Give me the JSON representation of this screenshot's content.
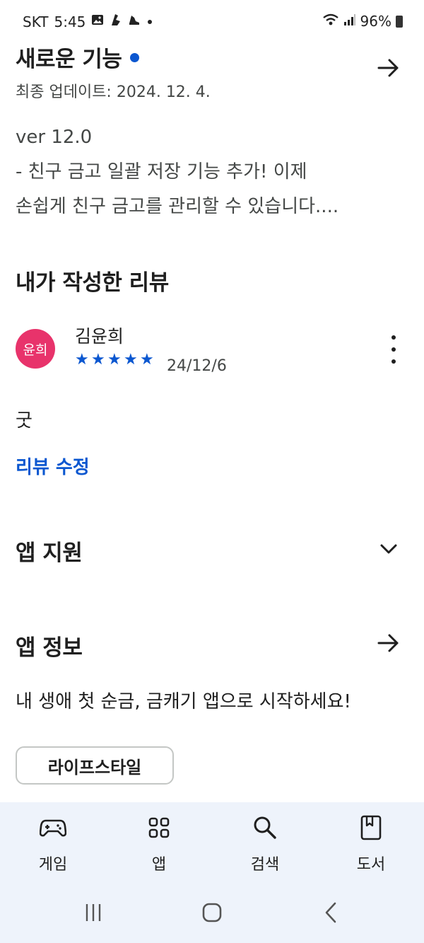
{
  "status_bar": {
    "carrier": "SKT",
    "time": "5:45",
    "battery": "96%",
    "icons": [
      "gallery-icon",
      "app-notification-icon",
      "sneaker-icon",
      "dot-icon",
      "wifi-icon",
      "signal-icon",
      "battery-icon"
    ]
  },
  "whats_new": {
    "title": "새로운 기능",
    "updated": "최종 업데이트: 2024. 12. 4.",
    "version": "ver 12.0",
    "line1": "- 친구 금고 일괄 저장 기능 추가! 이제",
    "line2": "손쉽게 친구 금고를 관리할 수 있습니다...."
  },
  "my_review": {
    "title": "내가 작성한 리뷰",
    "avatar_text": "윤희",
    "avatar_color": "#e8336b",
    "reviewer": "김윤희",
    "rating": 5,
    "stars": [
      "★",
      "★",
      "★",
      "★",
      "★"
    ],
    "date": "24/12/6",
    "text": "굿",
    "edit_label": "리뷰 수정"
  },
  "app_support": {
    "title": "앱 지원"
  },
  "app_info": {
    "title": "앱 정보",
    "description": "내 생애 첫 순금, 금캐기 앱으로 시작하세요!",
    "category": "라이프스타일"
  },
  "bottom_nav": {
    "items": [
      {
        "label": "게임",
        "icon": "gamepad-icon"
      },
      {
        "label": "앱",
        "icon": "apps-grid-icon"
      },
      {
        "label": "검색",
        "icon": "search-icon"
      },
      {
        "label": "도서",
        "icon": "book-icon"
      }
    ]
  },
  "colors": {
    "accent": "#0b57d0",
    "nav_background": "#eef3fb"
  }
}
